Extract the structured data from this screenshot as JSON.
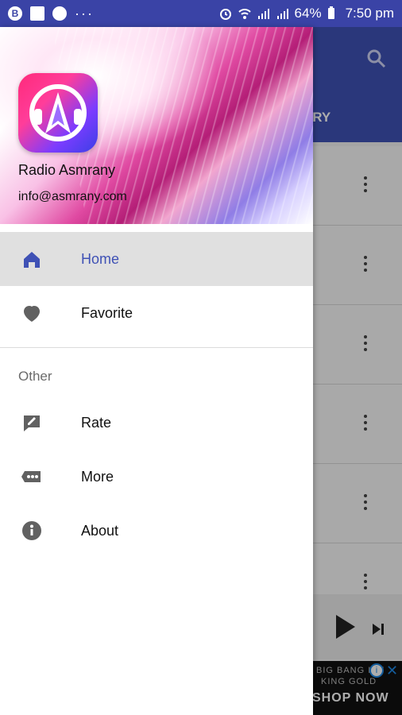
{
  "status_bar": {
    "left_icons": [
      "b-icon",
      "image-icon",
      "mic-icon"
    ],
    "overflow": "···",
    "battery": "64%",
    "time": "7:50 pm"
  },
  "background_app": {
    "tab_label_partial": "ORY",
    "player": {
      "play": "play-icon",
      "next": "skip-next-icon"
    },
    "ad": {
      "small_text": "BIG BANG INT",
      "small_text_2": "KING GOLD",
      "cta": "SHOP NOW"
    }
  },
  "drawer": {
    "header": {
      "app_name": "Radio Asmrany",
      "email": "info@asmrany.com"
    },
    "menu": [
      {
        "label": "Home",
        "icon": "home-icon",
        "active": true
      },
      {
        "label": "Favorite",
        "icon": "heart-icon",
        "active": false
      }
    ],
    "section_title": "Other",
    "other_menu": [
      {
        "label": "Rate",
        "icon": "rate-icon"
      },
      {
        "label": "More",
        "icon": "more-icon"
      },
      {
        "label": "About",
        "icon": "info-icon"
      }
    ]
  },
  "colors": {
    "primary": "#3f51b5",
    "status_bar": "#3a43a6",
    "active_bg": "#e0e0e0",
    "scrim": "rgba(0,0,0,0.32)"
  }
}
